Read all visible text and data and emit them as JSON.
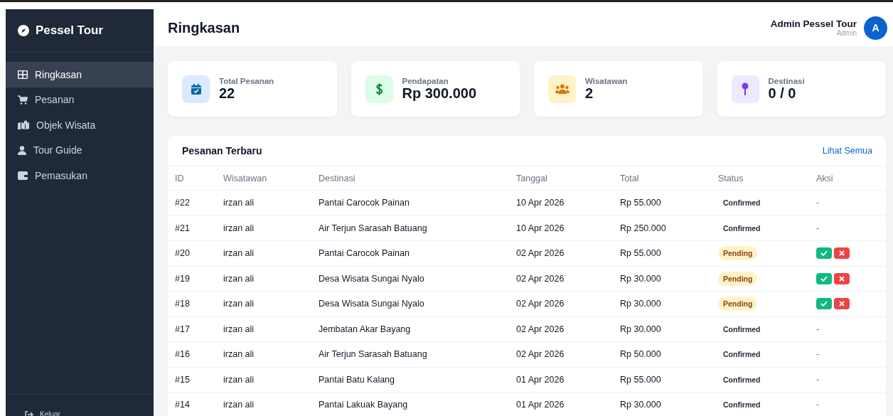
{
  "sidebar": {
    "brand": "Pessel Tour",
    "items": [
      {
        "label": "Ringkasan",
        "selected": true
      },
      {
        "label": "Pesanan",
        "selected": false
      },
      {
        "label": "Objek Wisata",
        "selected": false
      },
      {
        "label": "Tour Guide",
        "selected": false
      },
      {
        "label": "Pemasukan",
        "selected": false
      }
    ],
    "logout": "Keluar"
  },
  "header": {
    "title": "Ringkasan",
    "user_name": "Admin Pessel Tour",
    "user_role": "Admin",
    "avatar": "A"
  },
  "stats": [
    {
      "label": "Total Pesanan",
      "value": "22"
    },
    {
      "label": "Pendapatan",
      "value": "Rp 300.000"
    },
    {
      "label": "Wisatawan",
      "value": "2"
    },
    {
      "label": "Destinasi",
      "value": "0 / 0"
    }
  ],
  "table": {
    "title": "Pesanan Terbaru",
    "link": "Lihat Semua",
    "columns": [
      "ID",
      "Wisatawan",
      "Destinasi",
      "Tanggal",
      "Total",
      "Status",
      "Aksi"
    ],
    "rows": [
      {
        "id": "#22",
        "name": "irzan ali",
        "dest": "Pantai Carocok Painan",
        "date": "10 Apr 2026",
        "total": "Rp 55.000",
        "status": "Confirmed",
        "kind": "confirmed",
        "aksi": "-"
      },
      {
        "id": "#21",
        "name": "irzan ali",
        "dest": "Air Terjun Sarasah Batuang",
        "date": "10 Apr 2026",
        "total": "Rp 250.000",
        "status": "Confirmed",
        "kind": "confirmed",
        "aksi": "-"
      },
      {
        "id": "#20",
        "name": "irzan ali",
        "dest": "Pantai Carocok Painan",
        "date": "02 Apr 2026",
        "total": "Rp 55.000",
        "status": "Pending",
        "kind": "pending"
      },
      {
        "id": "#19",
        "name": "irzan ali",
        "dest": "Desa Wisata Sungai Nyalo",
        "date": "02 Apr 2026",
        "total": "Rp 30.000",
        "status": "Pending",
        "kind": "pending"
      },
      {
        "id": "#18",
        "name": "irzan ali",
        "dest": "Desa Wisata Sungai Nyalo",
        "date": "02 Apr 2026",
        "total": "Rp 30.000",
        "status": "Pending",
        "kind": "pending"
      },
      {
        "id": "#17",
        "name": "irzan ali",
        "dest": "Jembatan Akar Bayang",
        "date": "02 Apr 2026",
        "total": "Rp 30.000",
        "status": "Confirmed",
        "kind": "confirmed",
        "aksi": "-"
      },
      {
        "id": "#16",
        "name": "irzan ali",
        "dest": "Air Terjun Sarasah Batuang",
        "date": "02 Apr 2026",
        "total": "Rp 50.000",
        "status": "Confirmed",
        "kind": "confirmed",
        "aksi": "-"
      },
      {
        "id": "#15",
        "name": "irzan ali",
        "dest": "Pantai Batu Kalang",
        "date": "01 Apr 2026",
        "total": "Rp 55.000",
        "status": "Confirmed",
        "kind": "confirmed",
        "aksi": "-"
      },
      {
        "id": "#14",
        "name": "irzan ali",
        "dest": "Pantai Lakuak Bayang",
        "date": "01 Apr 2026",
        "total": "Rp 30.000",
        "status": "Confirmed",
        "kind": "confirmed",
        "aksi": "-"
      }
    ]
  }
}
